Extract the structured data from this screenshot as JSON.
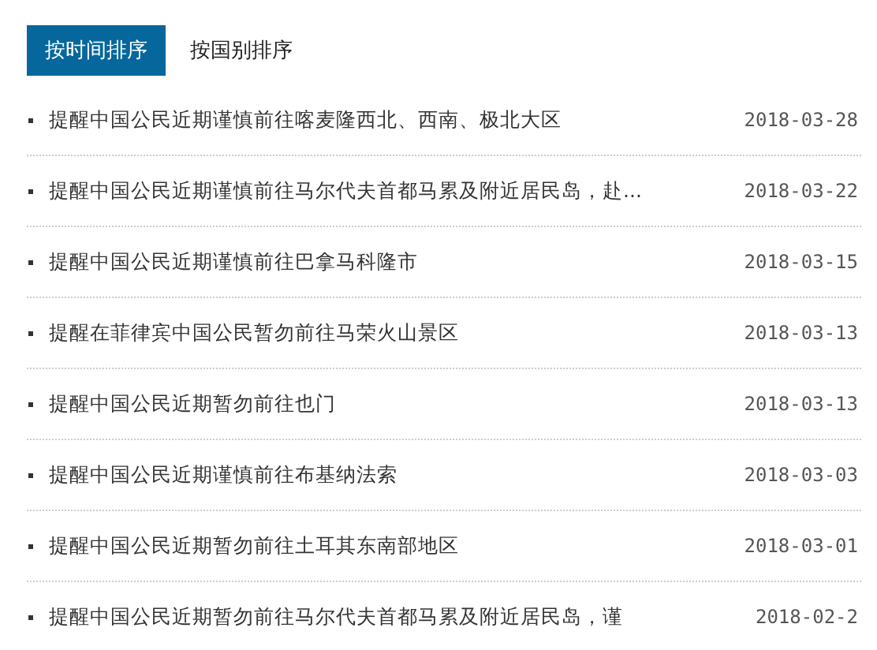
{
  "tabs": [
    {
      "label": "按时间排序",
      "selected": true
    },
    {
      "label": "按国别排序",
      "selected": false
    }
  ],
  "items": [
    {
      "title": "提醒中国公民近期谨慎前往喀麦隆西北、西南、极北大区",
      "date": "2018-03-28"
    },
    {
      "title": "提醒中国公民近期谨慎前往马尔代夫首都马累及附近居民岛，赴...",
      "date": "2018-03-22"
    },
    {
      "title": "提醒中国公民近期谨慎前往巴拿马科隆市",
      "date": "2018-03-15"
    },
    {
      "title": "提醒在菲律宾中国公民暂勿前往马荣火山景区",
      "date": "2018-03-13"
    },
    {
      "title": "提醒中国公民近期暂勿前往也门",
      "date": "2018-03-13"
    },
    {
      "title": "提醒中国公民近期谨慎前往布基纳法索",
      "date": "2018-03-03"
    },
    {
      "title": "提醒中国公民近期暂勿前往土耳其东南部地区",
      "date": "2018-03-01"
    },
    {
      "title": "提醒中国公民近期暂勿前往马尔代夫首都马累及附近居民岛，谨",
      "date": "2018-02-2"
    }
  ]
}
